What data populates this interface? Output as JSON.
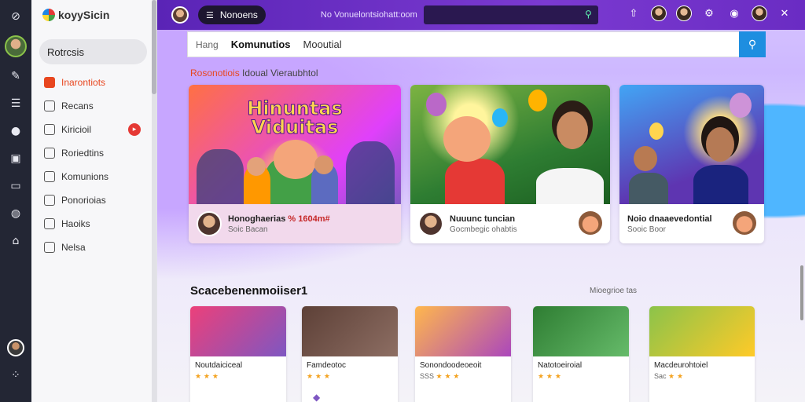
{
  "app": {
    "name": "koyySicin"
  },
  "rail": {
    "icons": [
      "settings-icon",
      "avatar",
      "pen-icon",
      "list-icon",
      "chat-icon",
      "book-icon",
      "monitor-icon",
      "help-icon",
      "home-icon"
    ]
  },
  "sidebar": {
    "active_label": "Rotrcsis",
    "items": [
      {
        "label": "Inarontiots",
        "icon": "play-icon",
        "highlight": true
      },
      {
        "label": "Recans",
        "icon": "doc-icon"
      },
      {
        "label": "Kiricioil",
        "icon": "video-icon",
        "badge": ""
      },
      {
        "label": "Roriedtins",
        "icon": "clip-icon"
      },
      {
        "label": "Komunions",
        "icon": "group-icon"
      },
      {
        "label": "Ponorioias",
        "icon": "list-icon"
      },
      {
        "label": "Haoiks",
        "icon": "bookmark-icon"
      },
      {
        "label": "Nelsa",
        "icon": "page-icon"
      }
    ]
  },
  "topbar": {
    "app_button": "Nonoens",
    "crumb": "No Vonuelontsiohatt:oom",
    "search_placeholder": ""
  },
  "search": {
    "chip": "Hang",
    "query_bold": "Komunutios",
    "query_rest": "Mooutial"
  },
  "featured": {
    "heading_pre": "Rosonotiois",
    "heading_rest": "Idoual Vieraubhtol",
    "cards": [
      {
        "poster_title": "Hinuntas Viduitas",
        "title": "Honoghaerias",
        "title_hi": "% 1604m#",
        "meta": "Soic Bacan"
      },
      {
        "poster_title": "",
        "title": "Nuuunc tuncian",
        "title_hi": "",
        "meta": "Gocmbegic ohabtis"
      },
      {
        "poster_title": "",
        "title": "Noio dnaaevedontial",
        "title_hi": "",
        "meta": "Sooic Boor"
      }
    ]
  },
  "section2": {
    "title": "Scacebenenmoiiser1",
    "see_all": "Mioegrioe tas"
  },
  "small_cards": [
    {
      "title": "Noutdaiciceal",
      "meta": "",
      "stars": "★ ★ ★"
    },
    {
      "title": "Famdeotoc",
      "meta": "",
      "stars": "★ ★ ★"
    },
    {
      "title": "Sonondoodeoeoit",
      "meta": "SSS",
      "stars": "★ ★ ★"
    },
    {
      "title": "Natotoeiroial",
      "meta": "",
      "stars": "★ ★ ★"
    },
    {
      "title": "Macdeurohtoiel",
      "meta": "Sac",
      "stars": "★ ★"
    }
  ],
  "colors": {
    "accent": "#7b3ad1",
    "search_button": "#1e8ee0",
    "highlight": "#e8461f",
    "rail": "#232634"
  }
}
